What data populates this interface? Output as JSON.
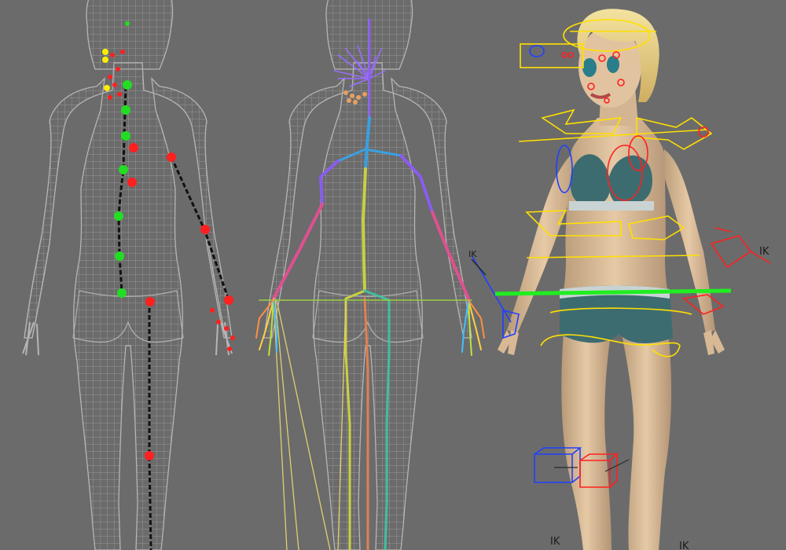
{
  "viewport": {
    "background": "#6b6b6b",
    "wire_color": "#9a9a9a",
    "panels": [
      {
        "name": "skin-weight-points-view",
        "markers": [
          "#ff2020",
          "#22dd22",
          "#ffee00"
        ]
      },
      {
        "name": "skeleton-joints-view",
        "bone_colors": [
          "#8a5cf0",
          "#3aa0e0",
          "#c8d040",
          "#e05090",
          "#40c0a0"
        ]
      },
      {
        "name": "rig-controls-view",
        "control_colors": [
          "#ffe000",
          "#2040ff",
          "#ff2020",
          "#20ee20"
        ]
      }
    ]
  },
  "labels": {
    "ik_right_arm": "IK",
    "ik_left_arm": "IK",
    "ik_bottom_a": "IK",
    "ik_bottom_b": "IK"
  }
}
